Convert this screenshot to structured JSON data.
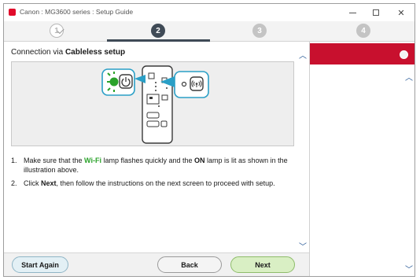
{
  "window": {
    "title": "Canon : MG3600 series : Setup Guide",
    "controls": {
      "minimize_icon": "minimize-icon",
      "maximize_icon": "maximize-icon",
      "close_label": "✕"
    }
  },
  "steps": [
    {
      "label": "1",
      "state": "completed"
    },
    {
      "label": "2",
      "state": "current"
    },
    {
      "label": "3",
      "state": "upcoming"
    },
    {
      "label": "4",
      "state": "upcoming"
    }
  ],
  "main": {
    "heading_prefix": "Connection via ",
    "heading_bold": "Cableless setup",
    "instructions": [
      {
        "number": "1.",
        "parts": [
          "Make sure that the ",
          "Wi-Fi",
          " lamp flashes quickly and the ",
          "ON",
          " lamp is lit as shown in the illustration above."
        ]
      },
      {
        "number": "2.",
        "parts": [
          "Click ",
          "Next",
          ", then follow the instructions on the next screen to proceed with setup."
        ]
      }
    ]
  },
  "footer": {
    "start_again": "Start Again",
    "back": "Back",
    "next": "Next"
  },
  "colors": {
    "accent_red": "#c8102e",
    "wifi_green": "#2aa22a",
    "lamp_blue": "#2a9fc6",
    "step_active": "#3f4a56",
    "next_button": "#d9efc4"
  }
}
